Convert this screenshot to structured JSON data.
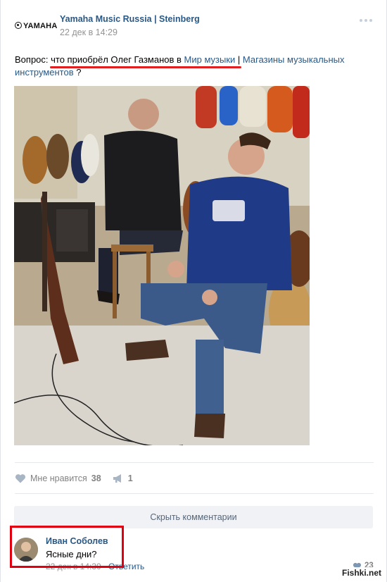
{
  "post": {
    "logo_text": "YAMAHA",
    "author": "Yamaha Music Russia | Steinberg",
    "date": "22 дек в 14:29",
    "text_prefix": "Вопрос: ",
    "text_underlined": "что приобрёл Олег Газманов в ",
    "link_1": "Мир музыки",
    "text_sep": " | ",
    "link_2": "Магазины музыкальных инструментов",
    "text_suffix": " ?"
  },
  "actions": {
    "like_label": "Мне нравится",
    "like_count": "38",
    "share_count": "1"
  },
  "comments": {
    "hide_label": "Скрыть комментарии",
    "items": [
      {
        "author": "Иван Соболев",
        "text": "Ясные дни?",
        "date": "22 дек в 14:30",
        "reply_label": "Ответить",
        "likes": "23"
      }
    ]
  },
  "watermark": "Fishki.net",
  "colors": {
    "link": "#2a5885",
    "meta": "#939393",
    "highlight": "#e00010"
  }
}
